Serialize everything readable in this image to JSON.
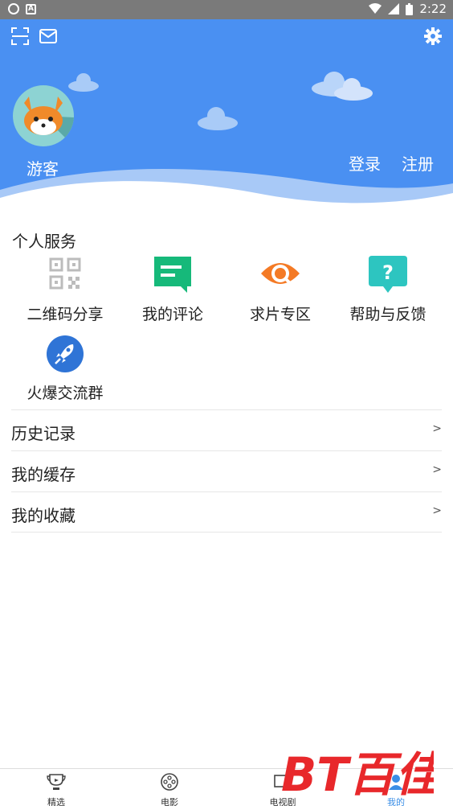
{
  "status_bar": {
    "time": "2:22"
  },
  "header": {
    "guest_name": "游客",
    "login": "登录",
    "register": "注册"
  },
  "personal_services": {
    "title": "个人服务",
    "items": [
      {
        "label": "二维码分享",
        "icon": "qr-code-icon"
      },
      {
        "label": "我的评论",
        "icon": "comment-icon"
      },
      {
        "label": "求片专区",
        "icon": "search-eye-icon"
      },
      {
        "label": "帮助与反馈",
        "icon": "help-icon"
      },
      {
        "label": "火爆交流群",
        "icon": "rocket-icon"
      }
    ]
  },
  "menu_list": [
    {
      "label": "历史记录",
      "chevron": ">"
    },
    {
      "label": "我的缓存",
      "chevron": ">"
    },
    {
      "label": "我的收藏",
      "chevron": ">"
    }
  ],
  "bottom_nav": [
    {
      "label": "精选",
      "icon": "trophy-icon"
    },
    {
      "label": "电影",
      "icon": "film-reel-icon"
    },
    {
      "label": "电视剧",
      "icon": "tv-icon"
    },
    {
      "label": "我的",
      "icon": "profile-icon"
    }
  ],
  "watermark": {
    "text": "BT百佳",
    "color": "#e8282b"
  },
  "colors": {
    "header_blue": "#4a90f2",
    "wave_light": "#a8c9f7"
  }
}
